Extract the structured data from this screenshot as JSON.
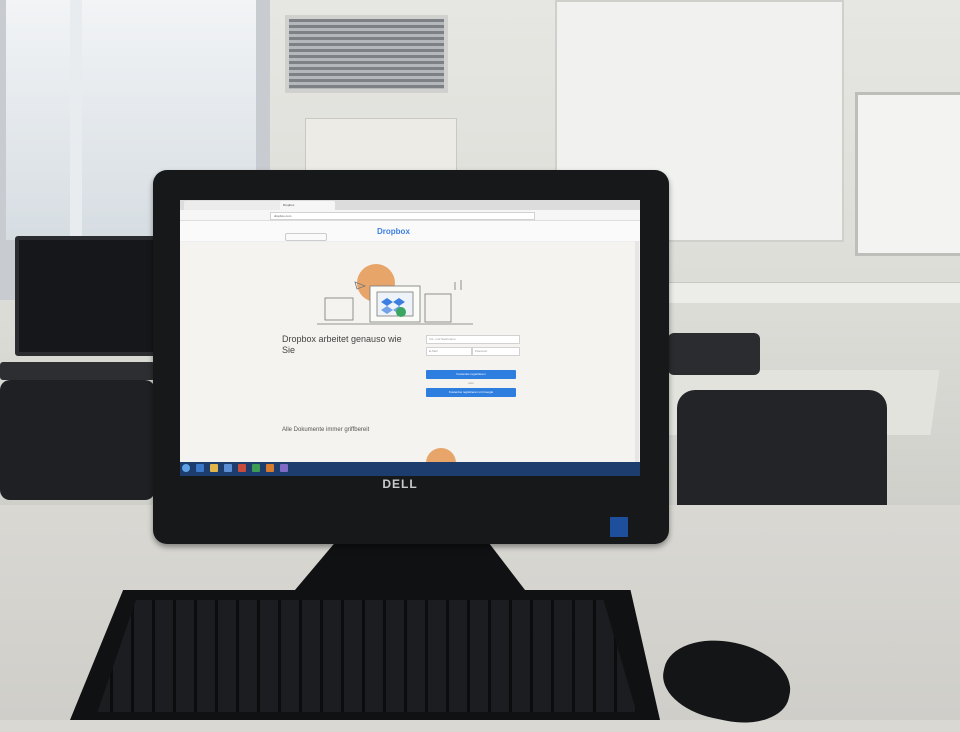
{
  "browser": {
    "tabs": [
      "",
      "",
      "Dropbox"
    ],
    "url": "dropbox.com"
  },
  "dropbox": {
    "logo": "Dropbox",
    "left_link": "",
    "right_links": "",
    "headline": "Dropbox arbeitet genauso wie Sie",
    "subtext": "",
    "field_name": "Vor- und Nachname",
    "field_email": "E-Mail",
    "field_password": "Passwort",
    "checkbox_text": "",
    "primary_button": "Kostenlos registrieren",
    "or_text": "oder",
    "google_button": "Kostenlos registrieren mit Google",
    "section2_title": "Alle Dokumente immer griffbereit",
    "section2_text": ""
  },
  "taskbar": {
    "clock_time": "",
    "clock_date": ""
  },
  "hardware": {
    "monitor_brand": "DELL"
  },
  "colors": {
    "dropbox_blue": "#2e7ee0",
    "accent_orange": "#e8a56a",
    "taskbar_blue": "#1c3d6e"
  }
}
